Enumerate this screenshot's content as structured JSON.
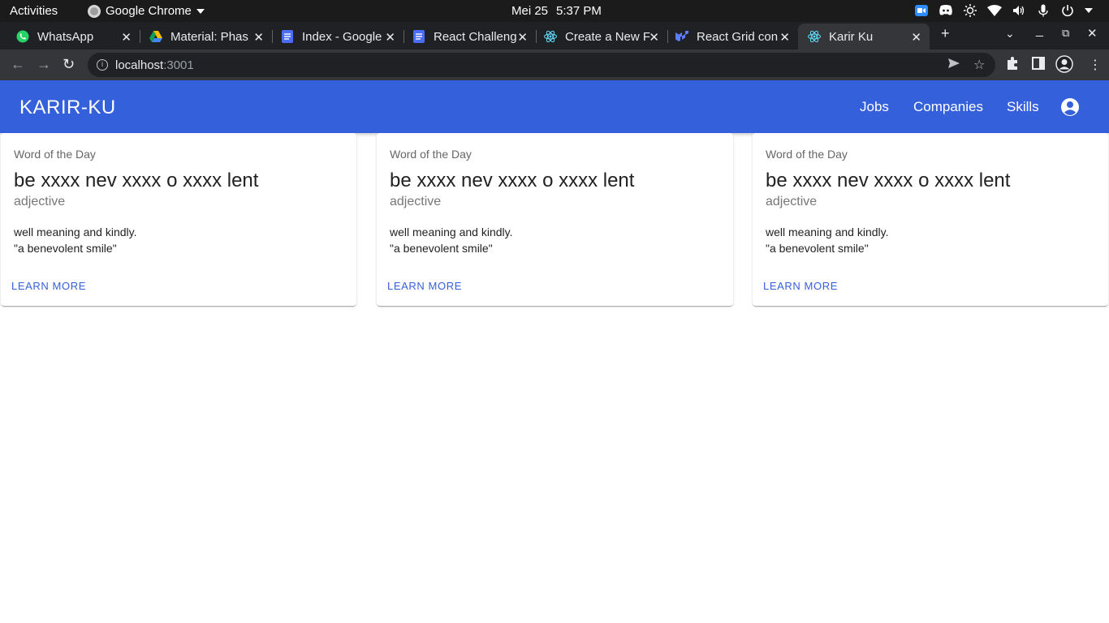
{
  "system_bar": {
    "activities": "Activities",
    "app_name": "Google Chrome",
    "date": "Mei 25",
    "time": "5:37 PM",
    "tray_icons": [
      "zoom-icon",
      "discord-icon",
      "brightness-icon",
      "wifi-icon",
      "volume-icon",
      "microphone-icon",
      "power-icon",
      "caret-down-icon"
    ]
  },
  "browser": {
    "tabs": [
      {
        "title": "WhatsApp",
        "icon": "whatsapp-icon",
        "active": false
      },
      {
        "title": "Material: Phas",
        "icon": "google-drive-icon",
        "active": false
      },
      {
        "title": "Index - Google",
        "icon": "google-docs-icon",
        "active": false
      },
      {
        "title": "React Challeng",
        "icon": "google-docs-icon",
        "active": false
      },
      {
        "title": "Create a New F",
        "icon": "react-icon",
        "active": false
      },
      {
        "title": "React Grid con",
        "icon": "mui-icon",
        "active": false
      },
      {
        "title": "Karir Ku",
        "icon": "react-icon",
        "active": true
      }
    ],
    "address": {
      "host": "localhost",
      "port": ":3001"
    }
  },
  "app": {
    "brand": "KARIR-KU",
    "nav": {
      "jobs": "Jobs",
      "companies": "Companies",
      "skills": "Skills"
    },
    "brand_color": "#3560dc"
  },
  "cards": [
    {
      "overline": "Word of the Day",
      "word": "be xxxx nev xxxx o xxxx lent",
      "part_of_speech": "adjective",
      "definition": "well meaning and kindly.",
      "example": "\"a benevolent smile\"",
      "action": "LEARN MORE"
    },
    {
      "overline": "Word of the Day",
      "word": "be xxxx nev xxxx o xxxx lent",
      "part_of_speech": "adjective",
      "definition": "well meaning and kindly.",
      "example": "\"a benevolent smile\"",
      "action": "LEARN MORE"
    },
    {
      "overline": "Word of the Day",
      "word": "be xxxx nev xxxx o xxxx lent",
      "part_of_speech": "adjective",
      "definition": "well meaning and kindly.",
      "example": "\"a benevolent smile\"",
      "action": "LEARN MORE"
    }
  ]
}
